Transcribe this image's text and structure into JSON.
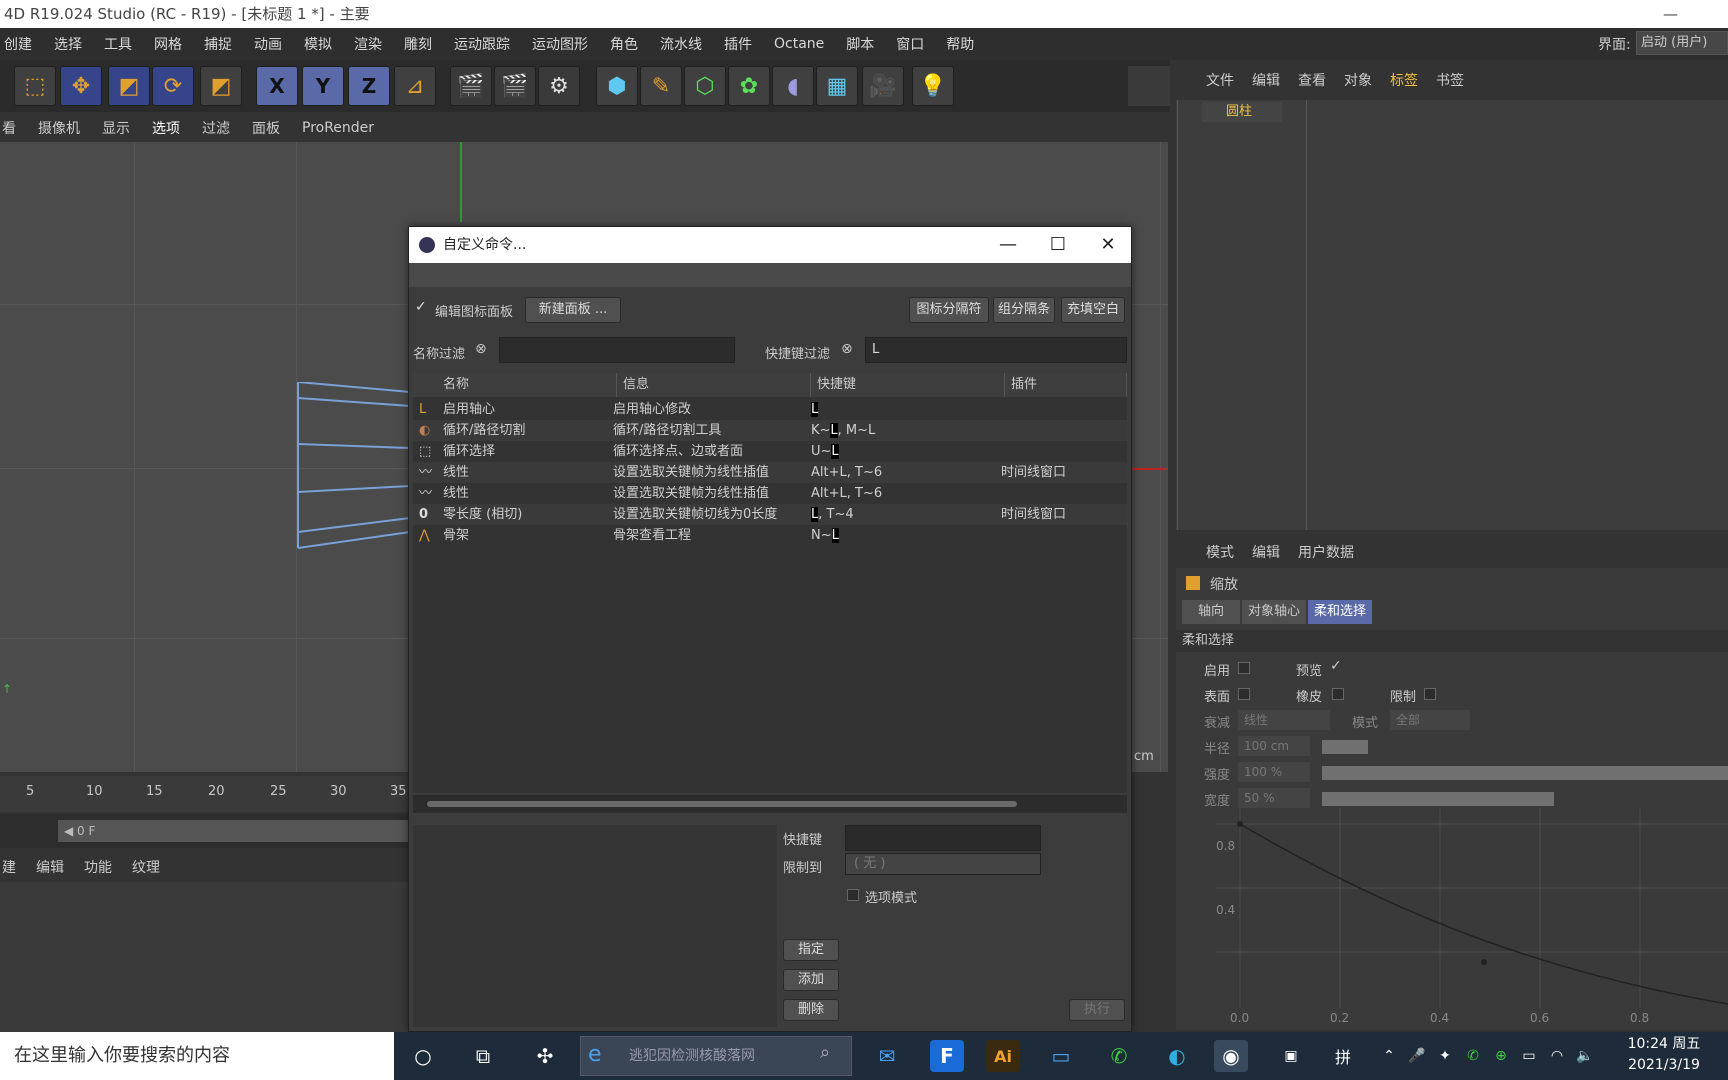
{
  "window": {
    "title": "4D R19.024 Studio (RC - R19) - [未标题 1 *] - 主要",
    "min_symbol": "—"
  },
  "menubar": {
    "items": [
      "创建",
      "选择",
      "工具",
      "网格",
      "捕捉",
      "动画",
      "模拟",
      "渲染",
      "雕刻",
      "运动跟踪",
      "运动图形",
      "角色",
      "流水线",
      "插件",
      "Octane",
      "脚本",
      "窗口",
      "帮助"
    ],
    "layout_label": "界面:",
    "layout_value": "启动 (用户)"
  },
  "toolbar": {
    "axes": [
      "X",
      "Y",
      "Z"
    ]
  },
  "viewport_menu": {
    "items": [
      "看",
      "摄像机",
      "显示",
      "选项",
      "过滤",
      "面板",
      "ProRender"
    ]
  },
  "viewport": {
    "unit_label": "cm"
  },
  "timeline": {
    "ticks": [
      "5",
      "10",
      "15",
      "20",
      "25",
      "30",
      "35"
    ],
    "frame_field": "◀ 0 F"
  },
  "material_menu": {
    "items": [
      "建",
      "编辑",
      "功能",
      "纹理"
    ]
  },
  "object_panel": {
    "menu": [
      "文件",
      "编辑",
      "查看",
      "对象",
      "标签",
      "书签"
    ],
    "object_name": "圆柱"
  },
  "attr_panel": {
    "menu": [
      "模式",
      "编辑",
      "用户数据"
    ],
    "tool_name": "缩放",
    "tabs": [
      "轴向",
      "对象轴心",
      "柔和选择"
    ],
    "section": "柔和选择",
    "rows": {
      "enable": "启用",
      "preview": "预览",
      "surface": "表面",
      "rubber": "橡皮",
      "limit": "限制",
      "falloff_label": "衰减",
      "falloff_value": "线性",
      "mode_label": "模式",
      "mode_value": "全部",
      "radius_label": "半径",
      "radius_value": "100 cm",
      "strength_label": "强度",
      "strength_value": "100 %",
      "width_label": "宽度",
      "width_value": "50 %"
    },
    "graph": {
      "y_ticks": [
        "0.8",
        "0.4"
      ],
      "x_ticks": [
        "0.0",
        "0.2",
        "0.4",
        "0.6",
        "0.8"
      ]
    }
  },
  "dialog": {
    "title": "自定义命令...",
    "edit_palette_label": "编辑图标面板",
    "new_palette_button": "新建面板 ...",
    "icon_separator_button": "图标分隔符",
    "group_separator_button": "组分隔条",
    "fill_space_button": "充填空白",
    "name_filter_label": "名称过滤",
    "name_filter_value": "",
    "shortcut_filter_label": "快捷键过滤",
    "shortcut_filter_value": "L",
    "columns": [
      "名称",
      "信息",
      "快捷键",
      "插件"
    ],
    "rows": [
      {
        "icon": "L",
        "name": "启用轴心",
        "info": "启用轴心修改",
        "sc_pre": "",
        "sc_hl": "L",
        "sc_post": "",
        "plugin": ""
      },
      {
        "icon": "◐",
        "name": "循环/路径切割",
        "info": "循环/路径切割工具",
        "sc_pre": "K~",
        "sc_hl": "L",
        "sc_post": ", M~L",
        "plugin": ""
      },
      {
        "icon": "⬚",
        "name": "循环选择",
        "info": "循环选择点、边或者面",
        "sc_pre": "U~",
        "sc_hl": "L",
        "sc_post": "",
        "plugin": ""
      },
      {
        "icon": "〰",
        "name": "线性",
        "info": "设置选取关键帧为线性插值",
        "sc_pre": "Alt+L, T~6",
        "sc_hl": "",
        "sc_post": "",
        "plugin": "时间线窗口"
      },
      {
        "icon": "〰",
        "name": "线性",
        "info": "设置选取关键帧为线性插值",
        "sc_pre": "Alt+L, T~6",
        "sc_hl": "",
        "sc_post": "",
        "plugin": ""
      },
      {
        "icon": "0",
        "name": "零长度 (相切)",
        "info": "设置选取关键帧切线为0长度",
        "sc_pre": "",
        "sc_hl": "L",
        "sc_post": ", T~4",
        "plugin": "时间线窗口"
      },
      {
        "icon": "⋀",
        "name": "骨架",
        "info": "骨架查看工程",
        "sc_pre": "N~",
        "sc_hl": "L",
        "sc_post": "",
        "plugin": ""
      }
    ],
    "shortcut_label": "快捷键",
    "restrict_label": "限制到",
    "restrict_value": "( 无 )",
    "option_mode_label": "选项模式",
    "assign_button": "指定",
    "add_button": "添加",
    "delete_button": "删除",
    "execute_button": "执行"
  },
  "taskbar": {
    "search_placeholder": "在这里输入你要搜索的内容",
    "edge_search": "逃犯因检测核酸落网",
    "ime": "拼",
    "time": "10:24 周五",
    "date": "2021/3/19"
  }
}
